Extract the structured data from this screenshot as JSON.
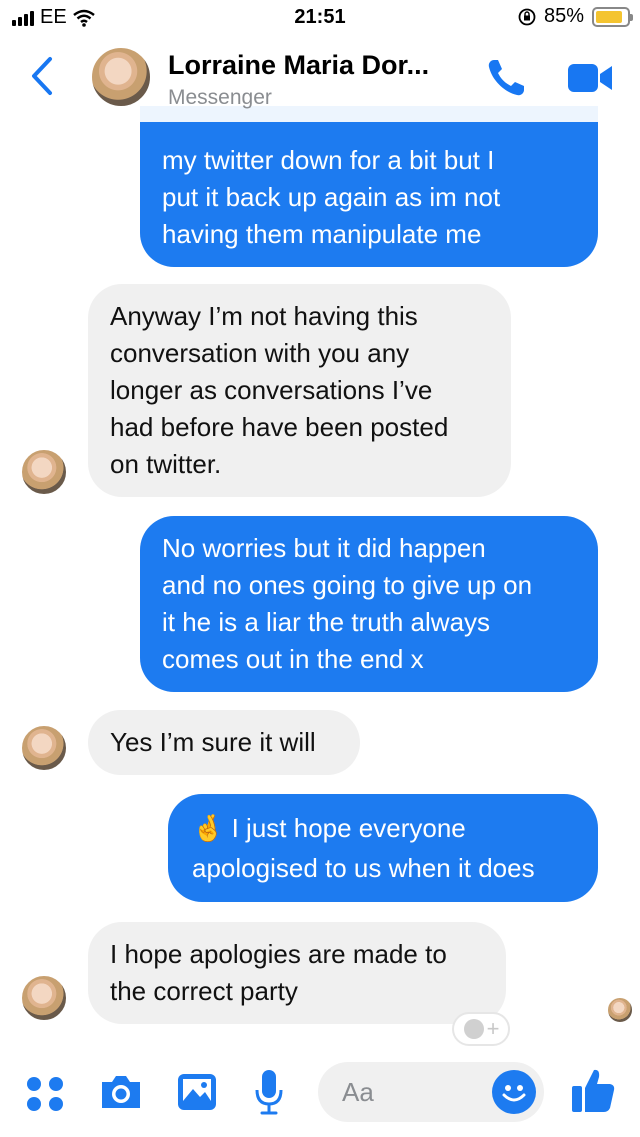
{
  "status_bar": {
    "carrier": "EE",
    "time": "21:51",
    "battery": "85%",
    "battery_level": 0.85
  },
  "header": {
    "back_icon": "chevron-left-icon",
    "name": "Lorraine Maria Dor...",
    "subtitle": "Messenger",
    "call_icon": "phone-icon",
    "video_icon": "video-camera-icon"
  },
  "messages": [
    {
      "direction": "out",
      "text": "my twitter down for a bit but I\nput it back up again as im not\nhaving them manipulate me"
    },
    {
      "direction": "in",
      "text": "Anyway I’m not having this\nconversation with you any\nlonger as conversations I’ve\nhad before have been posted\non twitter."
    },
    {
      "direction": "out",
      "text": "No worries but it did happen\nand no ones going to give up on\nit he is a liar the truth always\ncomes out in the end x"
    },
    {
      "direction": "in",
      "text": "Yes I’m sure it will"
    },
    {
      "direction": "out",
      "text": "🤞 I just hope everyone\napologised to us when it does"
    },
    {
      "direction": "in",
      "text": "I hope apologies are made to\nthe correct party"
    }
  ],
  "composer": {
    "placeholder": "Aa",
    "icons": [
      "menu-dots-icon",
      "camera-icon",
      "gallery-icon",
      "microphone-icon",
      "emoji-icon",
      "thumbs-up-icon"
    ],
    "react_label": "+"
  },
  "colors": {
    "accent": "#1d7bf0",
    "incoming_bubble": "#f0f0f0"
  }
}
